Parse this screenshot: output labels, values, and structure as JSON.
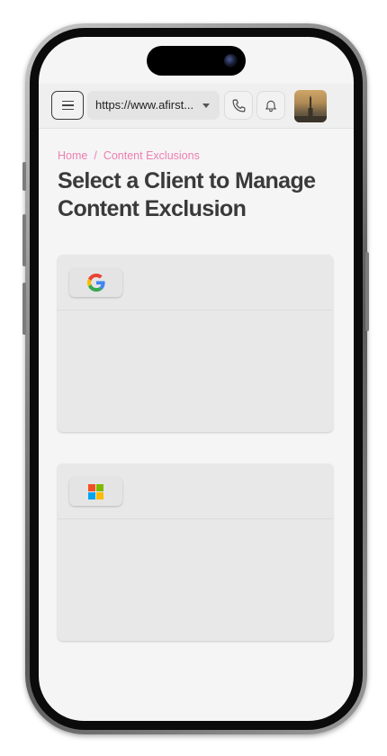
{
  "browser": {
    "url_display": "https://www.afirst..."
  },
  "breadcrumb": {
    "home": "Home",
    "separator": "/",
    "current": "Content Exclusions"
  },
  "page": {
    "title": "Select a Client to Manage Content Exclusion"
  },
  "clients": [
    {
      "name": "google",
      "logo_icon": "google-logo-icon"
    },
    {
      "name": "microsoft",
      "logo_icon": "microsoft-logo-icon"
    }
  ],
  "colors": {
    "breadcrumb": "#ee7fb0",
    "title": "#3a3a3a",
    "background": "#f5f5f5",
    "card": "#e8e8e8",
    "google_blue": "#4285F4",
    "google_red": "#EA4335",
    "google_yellow": "#FBBC05",
    "google_green": "#34A853",
    "ms_red": "#F25022",
    "ms_green": "#7FBA00",
    "ms_blue": "#00A4EF",
    "ms_yellow": "#FFB900"
  }
}
